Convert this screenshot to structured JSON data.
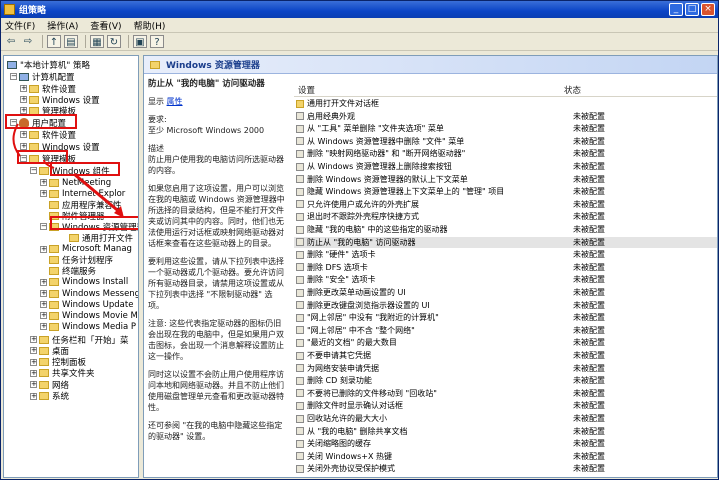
{
  "window": {
    "title": "组策略"
  },
  "menu": [
    "文件(F)",
    "操作(A)",
    "查看(V)",
    "帮助(H)"
  ],
  "toolbar": [
    "back-icon",
    "forward-icon",
    "up-icon",
    "show-tree-icon",
    "properties-icon",
    "refresh-icon",
    "export-icon",
    "help-icon"
  ],
  "tree": {
    "root": "\"本地计算机\" 策略",
    "computer_config": "计算机配置",
    "cc_items": [
      "软件设置",
      "Windows 设置",
      "管理模板"
    ],
    "user_config": "用户配置",
    "uc_items": [
      "软件设置",
      "Windows 设置"
    ],
    "admin_templates": "管理模板",
    "windows_components": "Windows 组件",
    "wc_items": [
      "NetMeeting",
      "Internet Explor",
      "应用程序兼容性",
      "附件管理器",
      "Windows 资源管理器",
      "通用打开文件",
      "Microsoft Manag",
      "任务计划程序",
      "终端服务",
      "Windows Install",
      "Windows Messeng",
      "Windows Update",
      "Windows Movie M",
      "Windows Media P"
    ],
    "other_items": [
      "任务栏和「开始」菜",
      "桌面",
      "控制面板",
      "共享文件夹",
      "网络",
      "系统"
    ]
  },
  "right": {
    "header": "Windows 资源管理器",
    "desc_title": "防止从 \"我的电脑\" 访问驱动器",
    "show_label": "显示",
    "properties_link": "属性",
    "requirements_label": "要求:",
    "requirements_text": "至少 Microsoft Windows 2000",
    "description_label": "描述",
    "paragraphs": [
      "防止用户使用我的电脑访问所选驱动器的内容。",
      "如果您启用了这项设置，用户可以浏览在我的电脑或 Windows 资源管理器中所选择的目录结构，但是不能打开文件夹或访问其中的内容。同时，他们也无法使用运行对话框或映射网络驱动器对话框来查看在这些驱动器上的目录。",
      "要利用这些设置，请从下拉列表中选择一个驱动器或几个驱动器。要允许访问所有驱动器目录，请禁用这项设置或从下拉列表中选择 \"不限制驱动器\" 选项。",
      "注意: 这些代表指定驱动器的图标仍旧会出现在我的电脑中，但是如果用户双击图标，会出现一个消息解释设置防止这一操作。",
      "同时这以设置不会防止用户使用程序访问本地和网络驱动器。并且不防止他们使用磁盘管理单元查看和更改驱动器特性。",
      "还可参阅 \"在我的电脑中隐藏这些指定的驱动器\" 设置。"
    ],
    "col_setting": "设置",
    "col_state": "状态",
    "rows": [
      {
        "name": "通用打开文件对话框",
        "state": "",
        "folder": true
      },
      {
        "name": "启用经典外观",
        "state": "未被配置"
      },
      {
        "name": "从 \"工具\" 菜单删除 \"文件夹选项\" 菜单",
        "state": "未被配置"
      },
      {
        "name": "从 Windows 资源管理器中删除 \"文件\" 菜单",
        "state": "未被配置"
      },
      {
        "name": "删除 \"映射网络驱动器\" 和 \"断开网络驱动器\"",
        "state": "未被配置"
      },
      {
        "name": "从 Windows 资源管理器上删除搜索按钮",
        "state": "未被配置"
      },
      {
        "name": "删除 Windows 资源管理器的默认上下文菜单",
        "state": "未被配置"
      },
      {
        "name": "隐藏 Windows 资源管理器上下文菜单上的 \"管理\" 项目",
        "state": "未被配置"
      },
      {
        "name": "只允许使用户或允许的外壳扩展",
        "state": "未被配置"
      },
      {
        "name": "退出时不跟踪外壳程序快捷方式",
        "state": "未被配置"
      },
      {
        "name": "隐藏 \"我的电脑\" 中的这些指定的驱动器",
        "state": "未被配置"
      },
      {
        "name": "防止从 \"我的电脑\" 访问驱动器",
        "state": "未被配置",
        "selected": true
      },
      {
        "name": "删除 \"硬件\" 选项卡",
        "state": "未被配置"
      },
      {
        "name": "删除 DFS 选项卡",
        "state": "未被配置"
      },
      {
        "name": "删除 \"安全\" 选项卡",
        "state": "未被配置"
      },
      {
        "name": "删除更改菜单动画设置的 UI",
        "state": "未被配置"
      },
      {
        "name": "删除更改键盘浏览指示器设置的 UI",
        "state": "未被配置"
      },
      {
        "name": "\"网上邻居\" 中没有 \"我附近的计算机\"",
        "state": "未被配置"
      },
      {
        "name": "\"网上邻居\" 中不含 \"整个网络\"",
        "state": "未被配置"
      },
      {
        "name": "\"最近的文档\" 的最大数目",
        "state": "未被配置"
      },
      {
        "name": "不要申请其它凭据",
        "state": "未被配置"
      },
      {
        "name": "为网络安装申请凭据",
        "state": "未被配置"
      },
      {
        "name": "删除 CD 刻录功能",
        "state": "未被配置"
      },
      {
        "name": "不要将已删除的文件移动到 \"回收站\"",
        "state": "未被配置"
      },
      {
        "name": "删除文件时显示确认对话框",
        "state": "未被配置"
      },
      {
        "name": "回收站允许的最大大小",
        "state": "未被配置"
      },
      {
        "name": "从 \"我的电脑\" 删除共享文档",
        "state": "未被配置"
      },
      {
        "name": "关闭缩略图的缓存",
        "state": "未被配置"
      },
      {
        "name": "关闭 Windows+X 热键",
        "state": "未被配置"
      },
      {
        "name": "关闭外壳协议受保护模式",
        "state": "未被配置"
      }
    ]
  },
  "colors": {
    "annotation": "#e01010",
    "titlebar": "#0b44c6"
  }
}
